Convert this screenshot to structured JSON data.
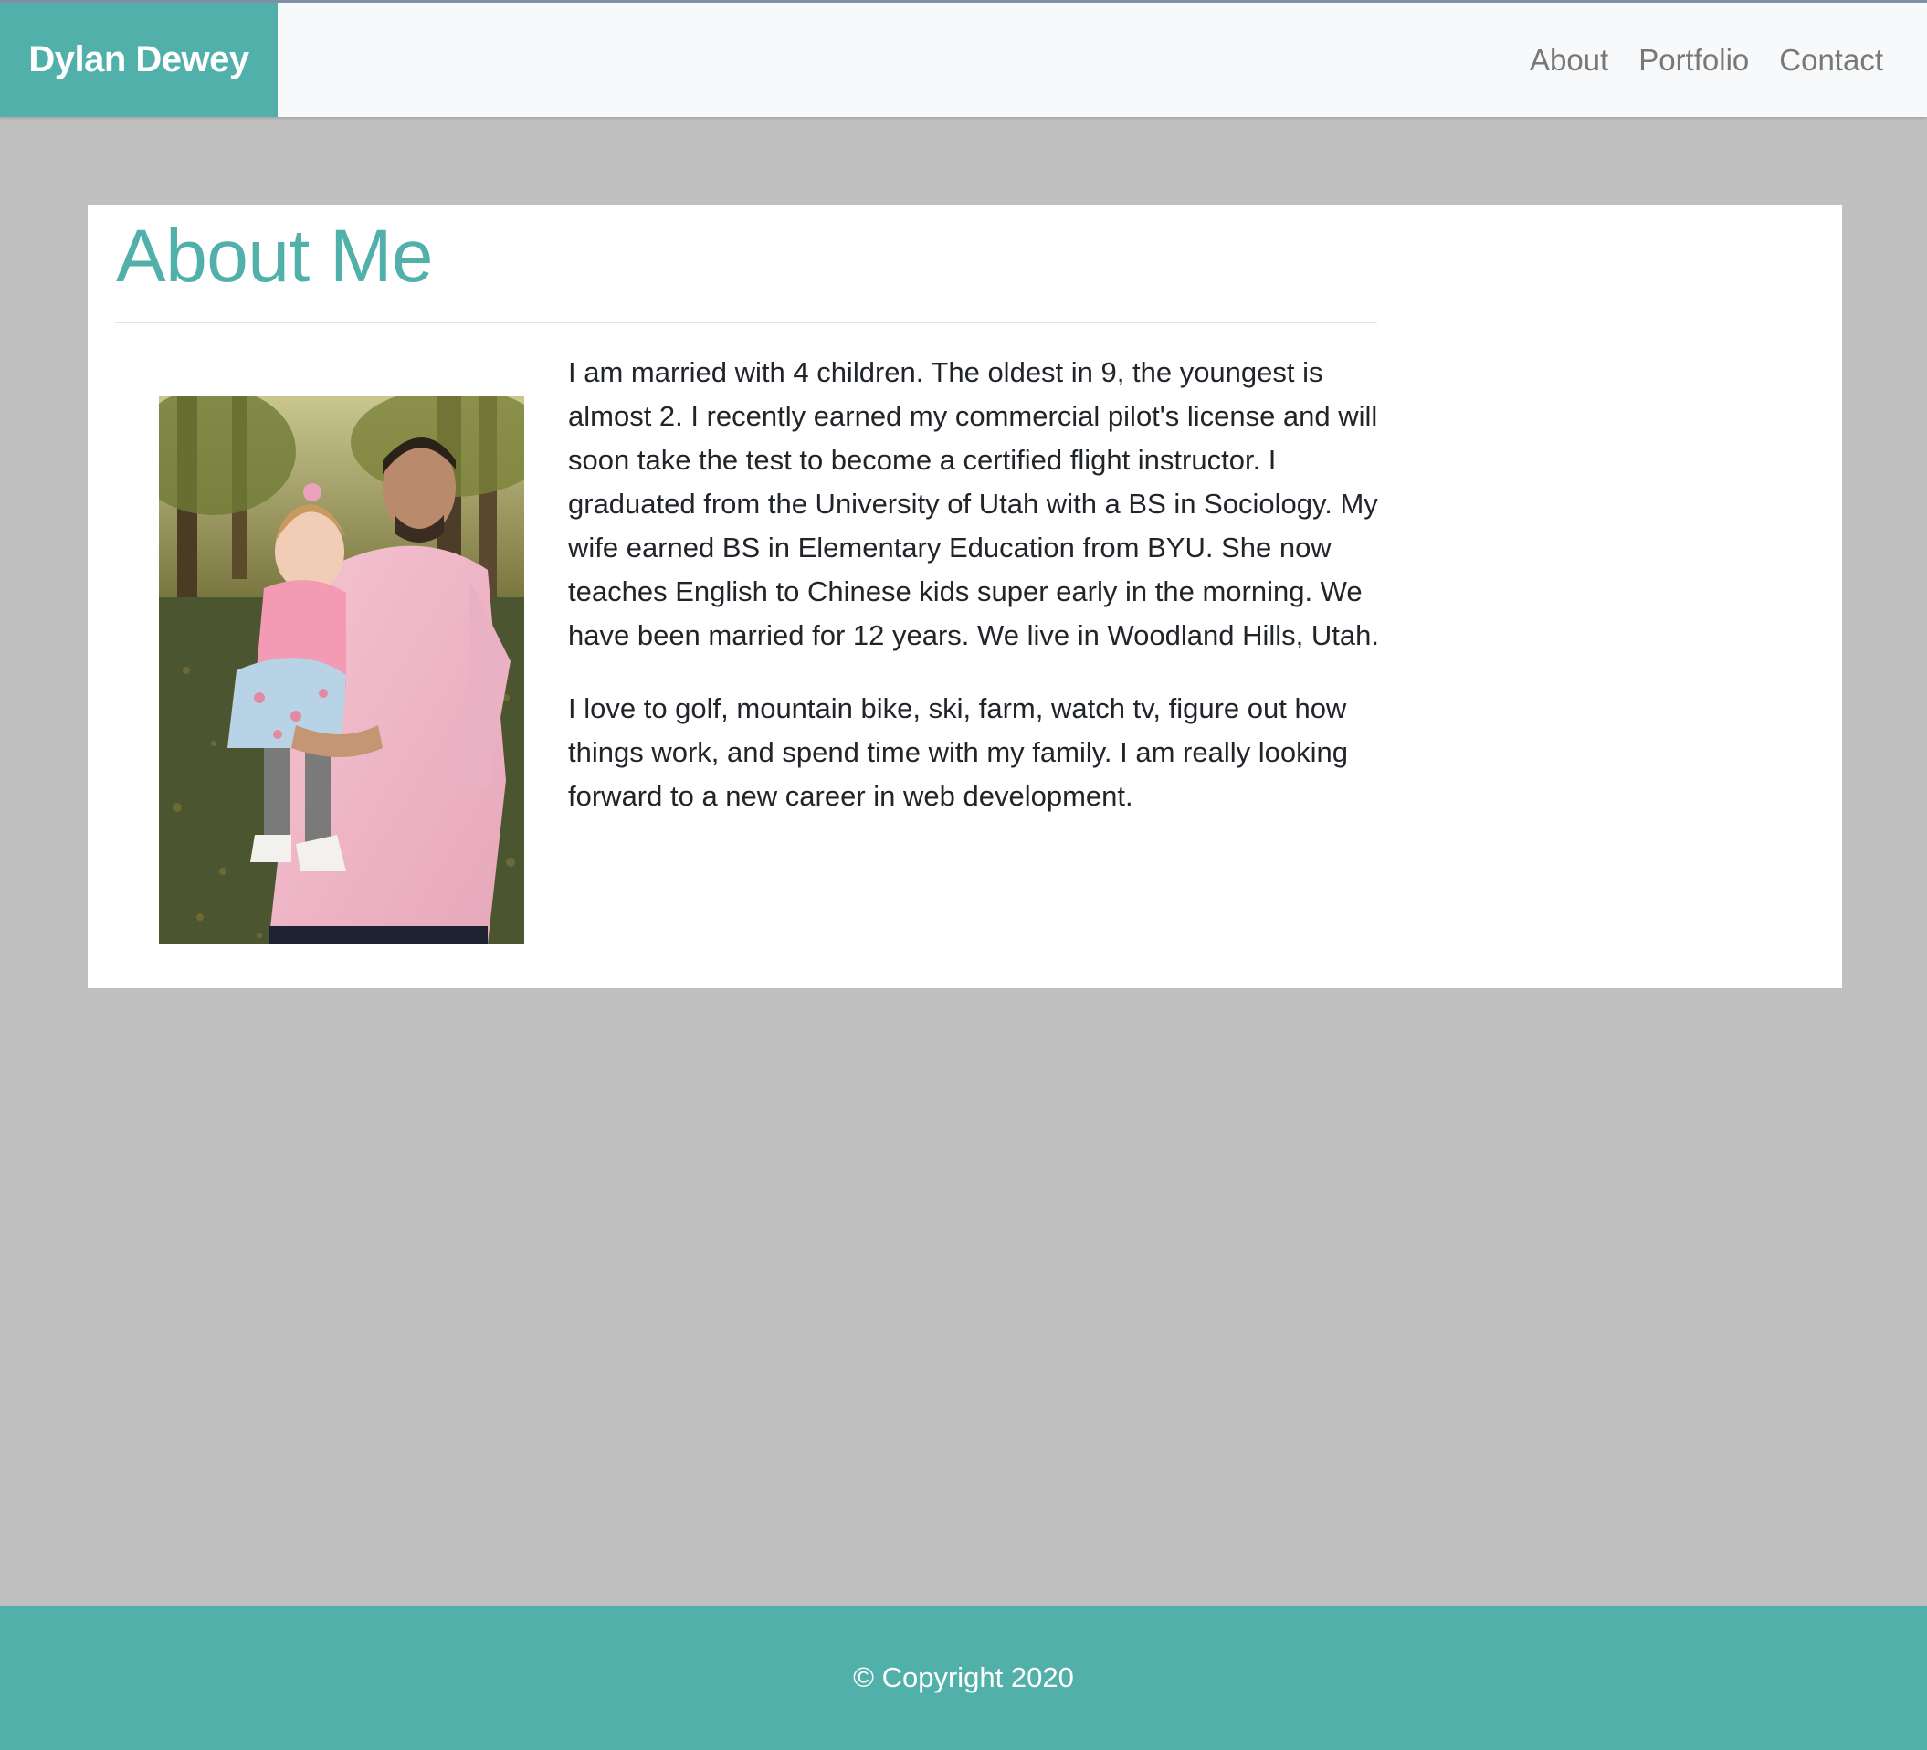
{
  "nav": {
    "brand": "Dylan Dewey",
    "links": [
      "About",
      "Portfolio",
      "Contact"
    ]
  },
  "about": {
    "title": "About Me",
    "paragraphs": [
      "I am married with 4 children. The oldest in 9, the youngest is almost 2. I recently earned my commercial pilot's license and will soon take the test to become a certified flight instructor. I graduated from the University of Utah with a BS in Sociology. My wife earned BS in Elementary Education from BYU. She now teaches English to Chinese kids super early in the morning. We have been married for 12 years. We live in Woodland Hills, Utah.",
      "I love to golf, mountain bike, ski, farm, watch tv, figure out how things work, and spend time with my family. I am really looking forward to a new career in web development."
    ]
  },
  "footer": {
    "copyright": "© Copyright 2020"
  },
  "colors": {
    "accent": "#52b0aa",
    "page_background": "#c0c0c0",
    "navbar_background": "#f8f9fa",
    "nav_link": "#787878",
    "body_text": "#212529"
  }
}
